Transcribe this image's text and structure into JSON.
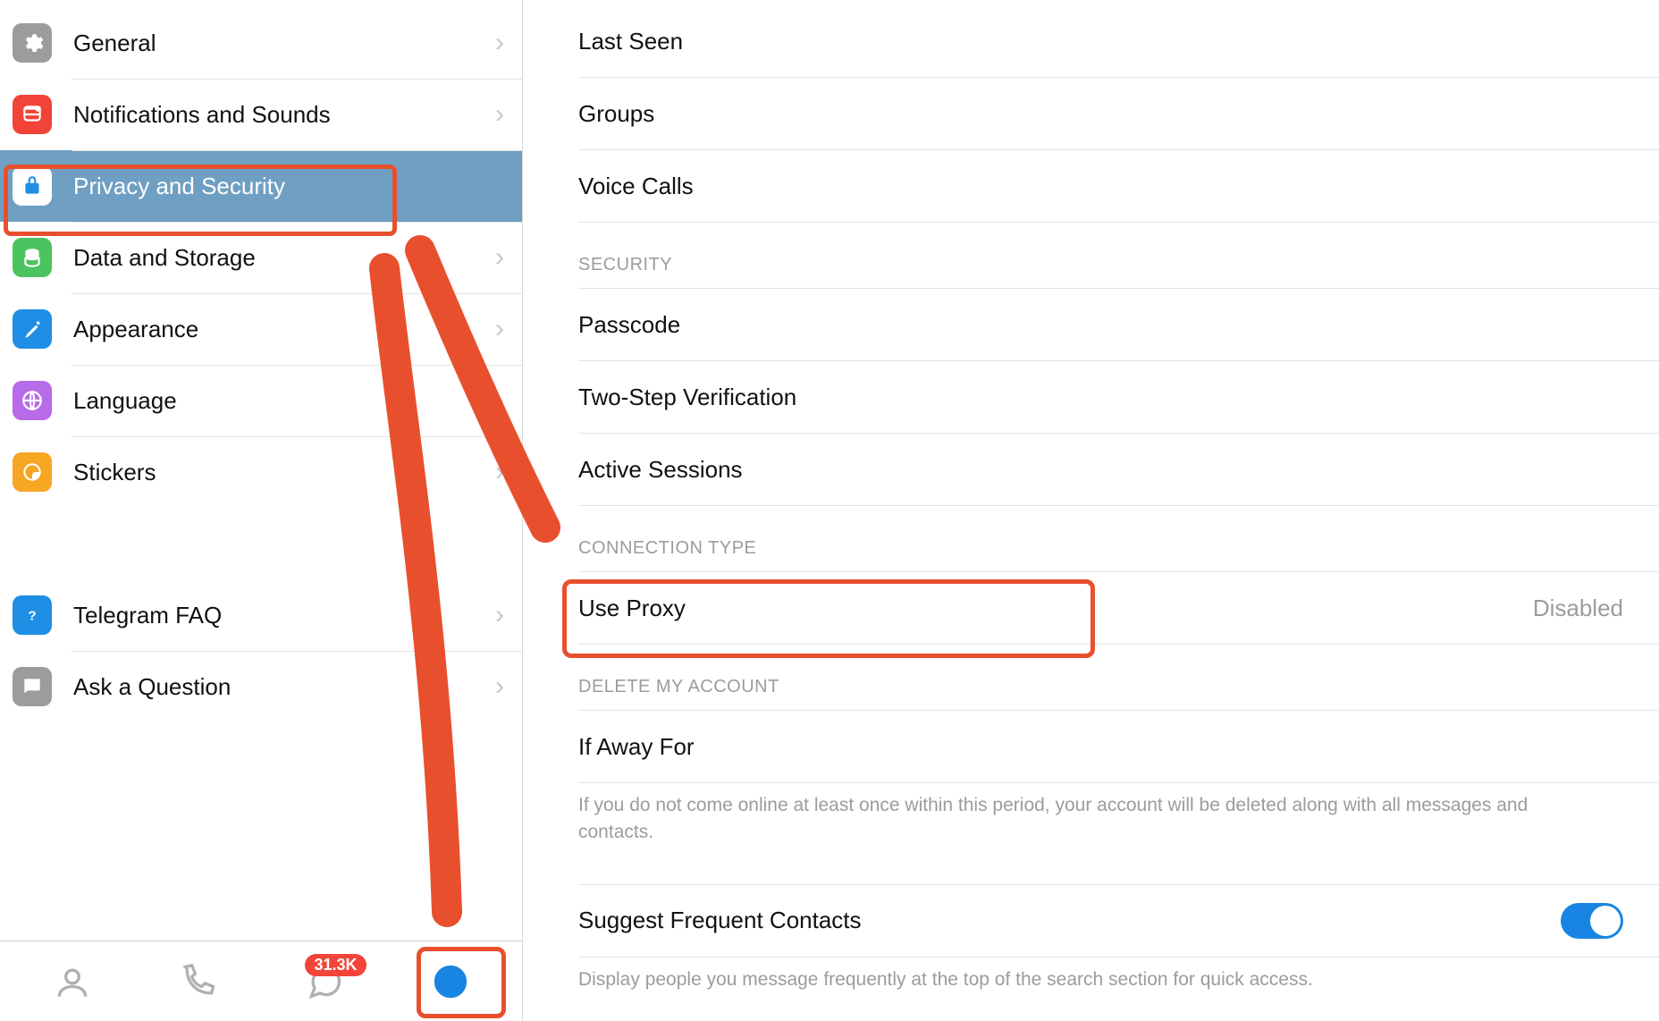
{
  "sidebar": {
    "items": [
      {
        "id": "general",
        "label": "General",
        "icon": "gear",
        "color": "#9c9c9c"
      },
      {
        "id": "notifications",
        "label": "Notifications and Sounds",
        "icon": "bell",
        "color": "#f14338"
      },
      {
        "id": "privacy",
        "label": "Privacy and Security",
        "icon": "lock",
        "color": "#1e8fe4",
        "active": true
      },
      {
        "id": "data",
        "label": "Data and Storage",
        "icon": "database",
        "color": "#4bc35e"
      },
      {
        "id": "appearance",
        "label": "Appearance",
        "icon": "brush",
        "color": "#1e8fe4"
      },
      {
        "id": "language",
        "label": "Language",
        "icon": "globe",
        "color": "#b86be8"
      },
      {
        "id": "stickers",
        "label": "Stickers",
        "icon": "sticker",
        "color": "#f6a623"
      }
    ],
    "support": [
      {
        "id": "faq",
        "label": "Telegram FAQ",
        "icon": "help",
        "color": "#1e8fe4"
      },
      {
        "id": "ask",
        "label": "Ask a Question",
        "icon": "chat",
        "color": "#9c9c9c"
      }
    ]
  },
  "tabbar": {
    "badge": "31.3K"
  },
  "detail": {
    "privacy_section": {
      "rows": [
        {
          "label": "Last Seen"
        },
        {
          "label": "Groups"
        },
        {
          "label": "Voice Calls"
        }
      ]
    },
    "security_section": {
      "header": "Security",
      "rows": [
        {
          "label": "Passcode"
        },
        {
          "label": "Two-Step Verification"
        },
        {
          "label": "Active Sessions"
        }
      ]
    },
    "connection_section": {
      "header": "Connection Type",
      "row": {
        "label": "Use Proxy",
        "value": "Disabled"
      }
    },
    "delete_section": {
      "header": "Delete My Account",
      "row": {
        "label": "If Away For"
      },
      "desc": "If you do not come online at least once within this period, your account will be deleted along with all messages and contacts."
    },
    "suggest_section": {
      "row": {
        "label": "Suggest Frequent Contacts"
      },
      "desc": "Display people you message frequently at the top of the search section for quick access."
    }
  },
  "annotation": {
    "color": "#e8502d"
  }
}
